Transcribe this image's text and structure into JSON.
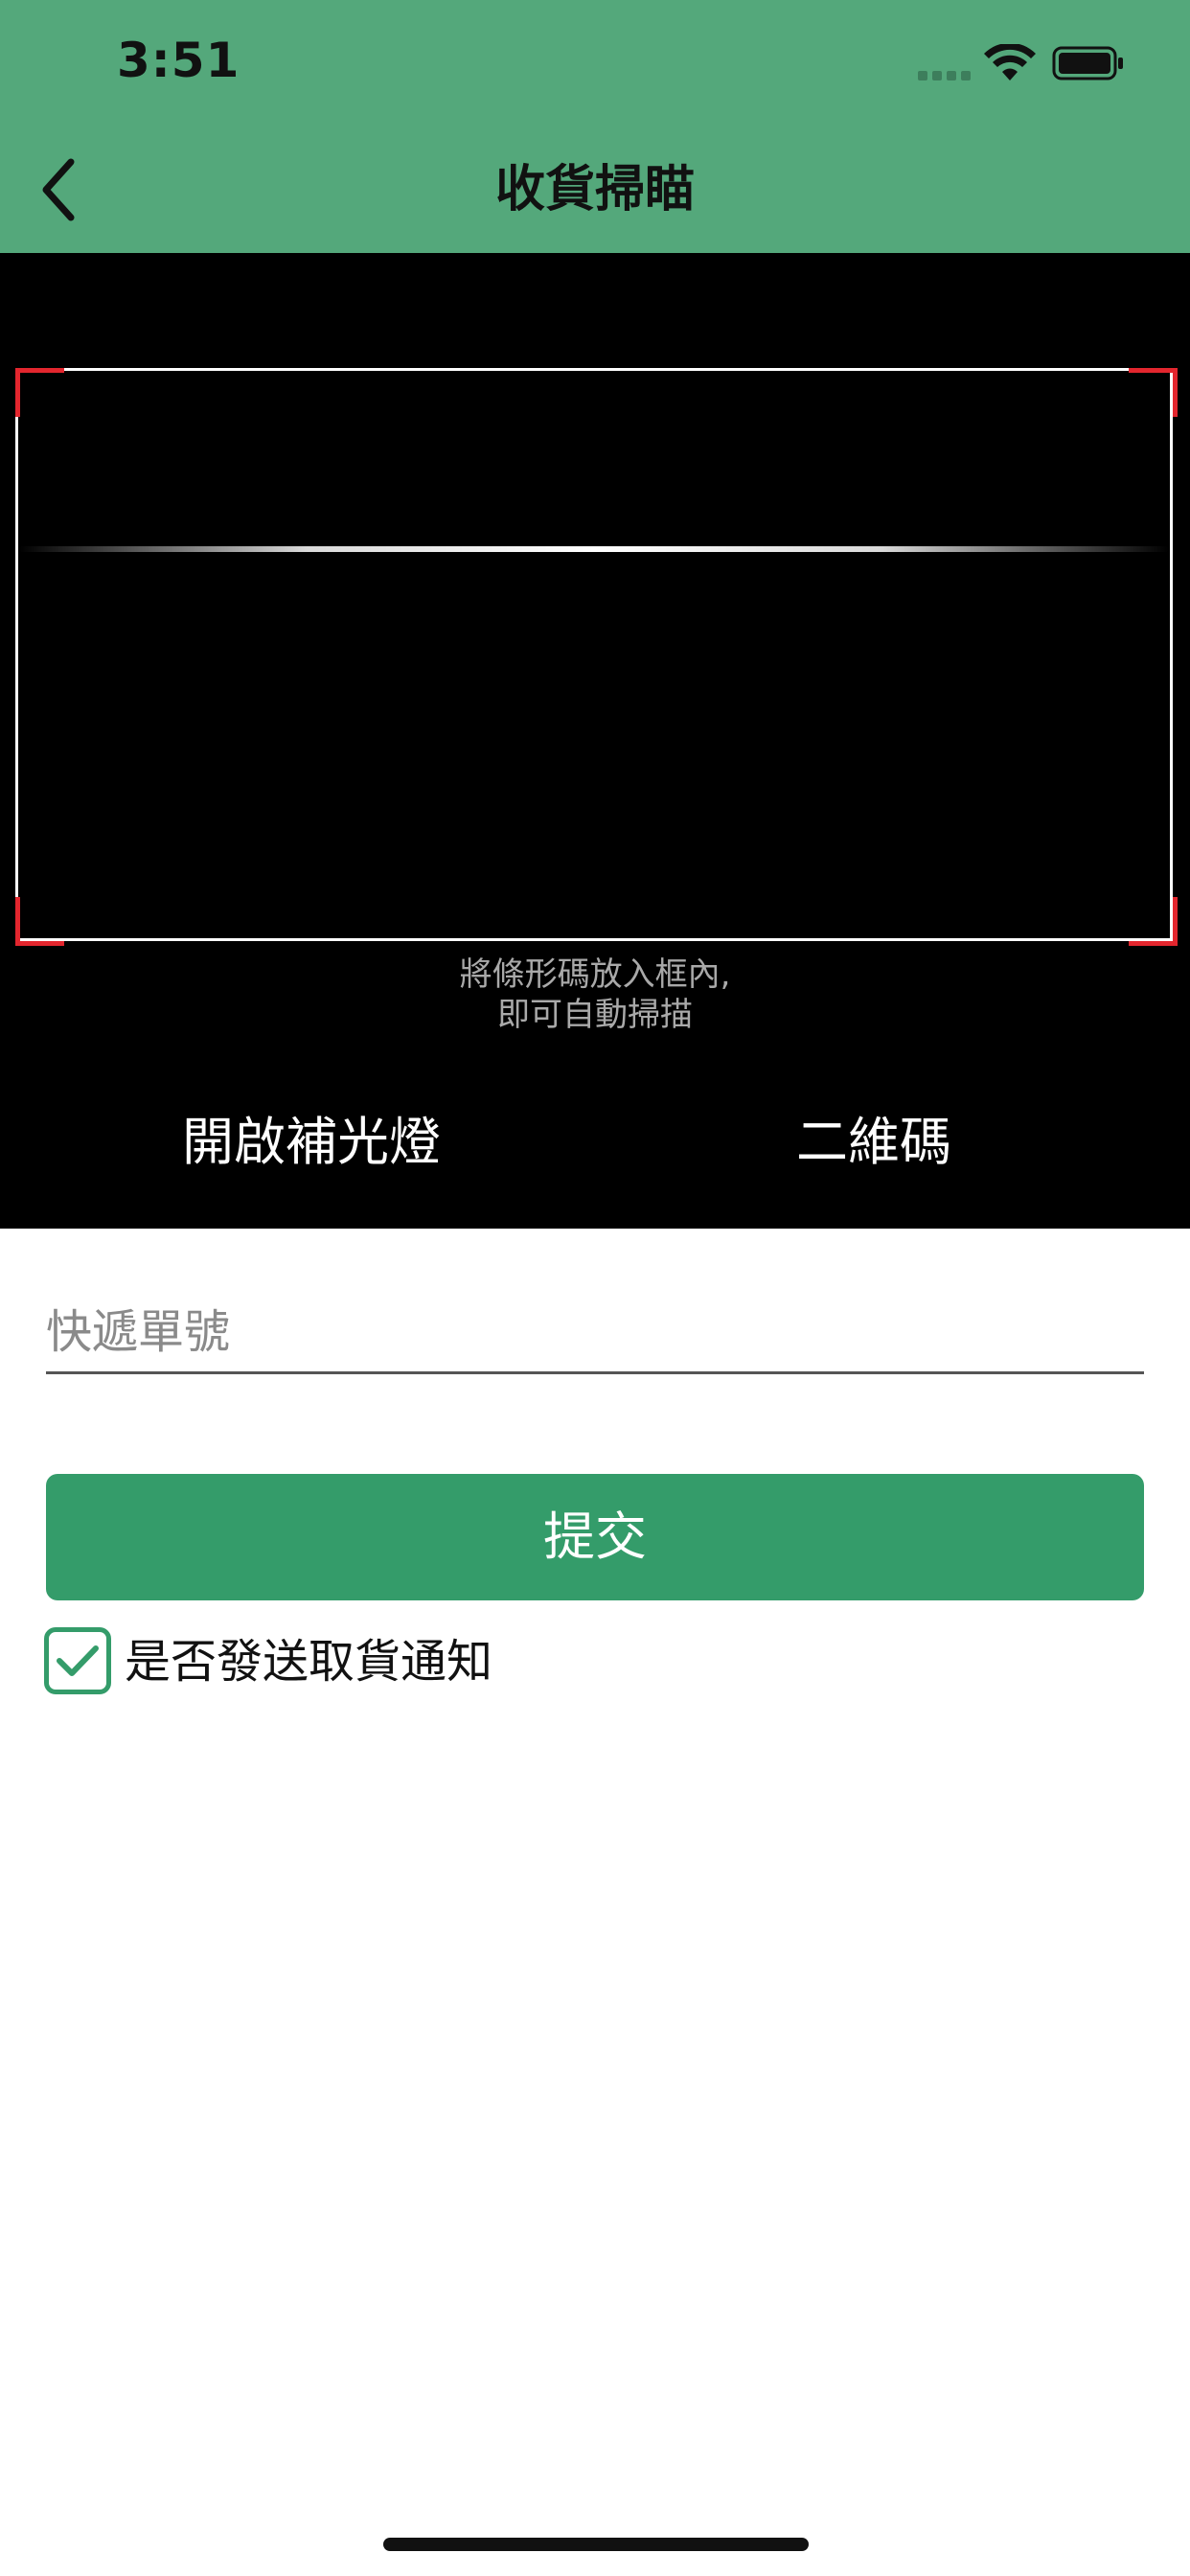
{
  "status_bar": {
    "time": "3:51"
  },
  "nav": {
    "title": "收貨掃瞄",
    "back_icon": "chevron-left-icon"
  },
  "scanner": {
    "hint_line1": "將條形碼放入框內,",
    "hint_line2": "即可自動掃描",
    "flash_label": "開啟補光燈",
    "qr_label": "二維碼",
    "corner_color": "#e3262e"
  },
  "form": {
    "tracking_placeholder": "快遞單號",
    "tracking_value": "",
    "submit_label": "提交",
    "notify_label": "是否發送取貨通知",
    "notify_checked": true
  },
  "colors": {
    "header_bg": "#54a87b",
    "accent": "#349c6a",
    "camera_bg": "#000000"
  }
}
